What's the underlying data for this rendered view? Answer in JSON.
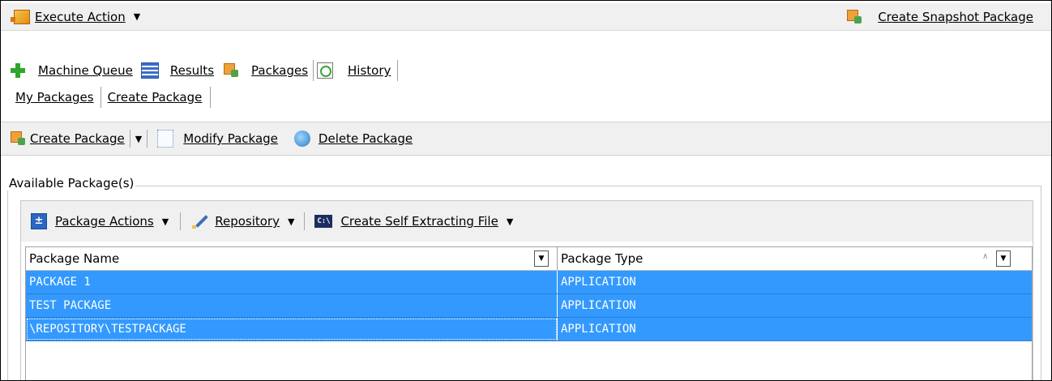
{
  "topbar": {
    "execute_label": "Execute Action",
    "execute_icon": "execute-action-icon",
    "snapshot_label": "Create Snapshot Package",
    "snapshot_icon": "snapshot-package-icon"
  },
  "main_tabs": [
    {
      "label": "Machine Queue",
      "icon": "plus-icon"
    },
    {
      "label": "Results",
      "icon": "results-icon"
    },
    {
      "label": "Packages",
      "icon": "packages-icon",
      "active": true
    },
    {
      "label": "History",
      "icon": "history-icon"
    }
  ],
  "sub_tabs": [
    {
      "label": "My Packages",
      "active": true
    },
    {
      "label": "Create Package"
    }
  ],
  "toolbar": {
    "create_label": "Create Package",
    "modify_label": "Modify Package",
    "delete_label": "Delete Package"
  },
  "available": {
    "group_label": "Available Package(s)",
    "actions": {
      "package_actions": "Package Actions",
      "repository": "Repository",
      "self_extract": "Create Self Extracting File"
    },
    "columns": [
      "Package Name",
      "Package Type"
    ],
    "rows": [
      {
        "name": "PACKAGE 1",
        "type": "APPLICATION"
      },
      {
        "name": "TEST PACKAGE",
        "type": "APPLICATION"
      },
      {
        "name": "\\REPOSITORY\\TESTPACKAGE",
        "type": "APPLICATION"
      }
    ],
    "selection_color": "#3399ff"
  }
}
